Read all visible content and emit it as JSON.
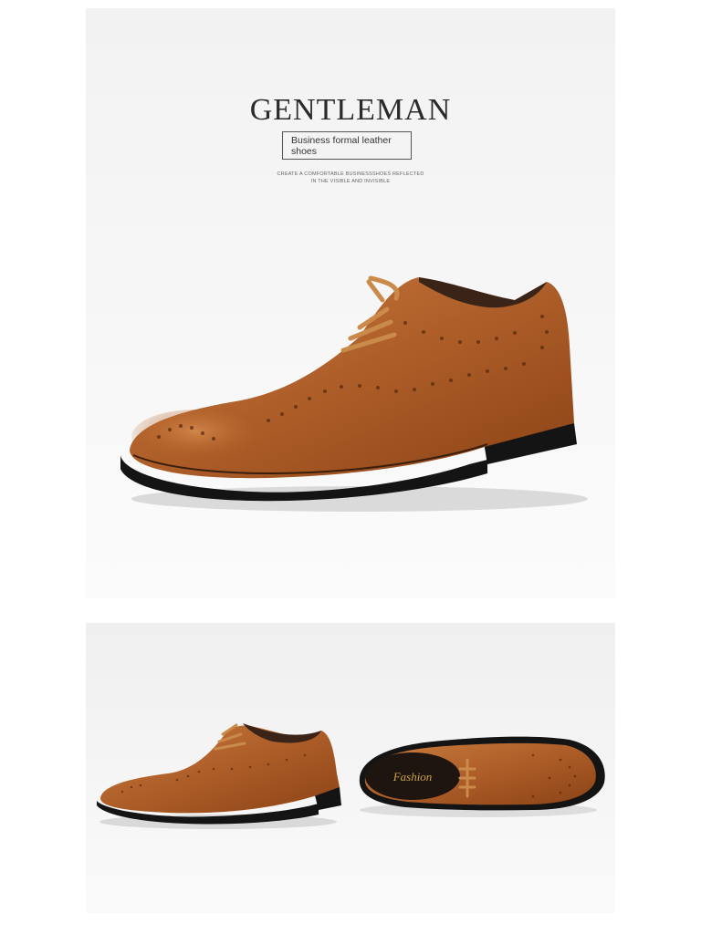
{
  "hero": {
    "title": "GENTLEMAN",
    "subtitle": "Business formal leather shoes",
    "tagline_line1": "CREATE A COMFORTABLE BUSINESSSHOES REFLECTED",
    "tagline_line2": "IN THE VISIBLE AND INVISIBLE"
  },
  "gallery": {
    "insole_text": "Fashion"
  },
  "colors": {
    "leather": "#a8541c",
    "leather_light": "#c97c3e",
    "sole": "#141414",
    "background": "#f3f3f3"
  }
}
